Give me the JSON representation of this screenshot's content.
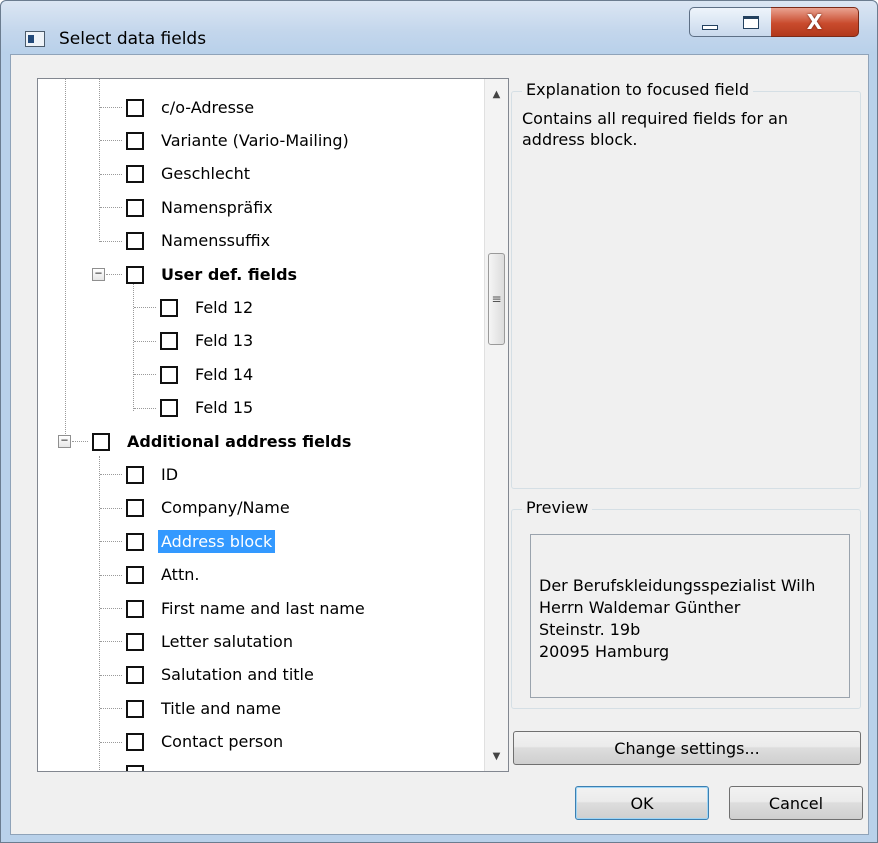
{
  "window": {
    "title": "Select data fields"
  },
  "controls": {
    "close_glyph": "X"
  },
  "tree": {
    "rows": [
      {
        "label": "c/o-Adresse",
        "bold": false,
        "selected": false
      },
      {
        "label": "Variante (Vario-Mailing)",
        "bold": false,
        "selected": false
      },
      {
        "label": "Geschlecht",
        "bold": false,
        "selected": false
      },
      {
        "label": "Namenspräfix",
        "bold": false,
        "selected": false
      },
      {
        "label": "Namenssuffix",
        "bold": false,
        "selected": false
      },
      {
        "label": "User def. fields",
        "bold": true,
        "selected": false
      },
      {
        "label": "Feld 12",
        "bold": false,
        "selected": false
      },
      {
        "label": "Feld 13",
        "bold": false,
        "selected": false
      },
      {
        "label": "Feld 14",
        "bold": false,
        "selected": false
      },
      {
        "label": "Feld 15",
        "bold": false,
        "selected": false
      },
      {
        "label": "Additional address fields",
        "bold": true,
        "selected": false
      },
      {
        "label": "ID",
        "bold": false,
        "selected": false
      },
      {
        "label": "Company/Name",
        "bold": false,
        "selected": false
      },
      {
        "label": "Address block",
        "bold": false,
        "selected": true
      },
      {
        "label": "Attn.",
        "bold": false,
        "selected": false
      },
      {
        "label": "First name and last name",
        "bold": false,
        "selected": false
      },
      {
        "label": "Letter salutation",
        "bold": false,
        "selected": false
      },
      {
        "label": "Salutation and title",
        "bold": false,
        "selected": false
      },
      {
        "label": "Title and name",
        "bold": false,
        "selected": false
      },
      {
        "label": "Contact person",
        "bold": false,
        "selected": false
      }
    ],
    "expander_glyph": "−"
  },
  "explanation": {
    "title": "Explanation to focused field",
    "text": "Contains all required fields for an address block."
  },
  "preview": {
    "title": "Preview",
    "lines": [
      "Der Berufskleidungsspezialist Wilh",
      "Herrn Waldemar Günther",
      "Steinstr. 19b",
      "20095 Hamburg"
    ]
  },
  "buttons": {
    "change_settings": "Change settings...",
    "ok": "OK",
    "cancel": "Cancel"
  }
}
